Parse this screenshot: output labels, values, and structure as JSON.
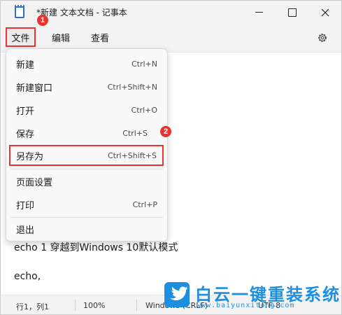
{
  "window": {
    "title": "*新建 文本文档 - 记事本"
  },
  "menubar": {
    "file": "文件",
    "edit": "编辑",
    "view": "查看"
  },
  "file_menu": {
    "items": [
      {
        "label": "新建",
        "shortcut": "Ctrl+N"
      },
      {
        "label": "新建窗口",
        "shortcut": "Ctrl+Shift+N"
      },
      {
        "label": "打开",
        "shortcut": "Ctrl+O"
      },
      {
        "label": "保存",
        "shortcut": "Ctrl+S"
      },
      {
        "label": "另存为",
        "shortcut": "Ctrl+Shift+S"
      },
      {
        "label": "页面设置",
        "shortcut": ""
      },
      {
        "label": "打印",
        "shortcut": "Ctrl+P"
      },
      {
        "label": "退出",
        "shortcut": ""
      }
    ]
  },
  "editor": {
    "lines": [
      "echo 1 穿越到Windows 10默认模式",
      "echo,"
    ]
  },
  "statusbar": {
    "position": "行1，列1",
    "zoom": "100%",
    "line_ending": "Windows (CRLF)",
    "encoding": "UTF-8"
  },
  "annotations": {
    "badge1": "1",
    "badge2": "2"
  },
  "watermark": {
    "title": "白云一键重装系统",
    "url": "www.baiyunxitong.com"
  },
  "colors": {
    "highlight": "#e8332f",
    "brand": "#1d8fe0"
  }
}
